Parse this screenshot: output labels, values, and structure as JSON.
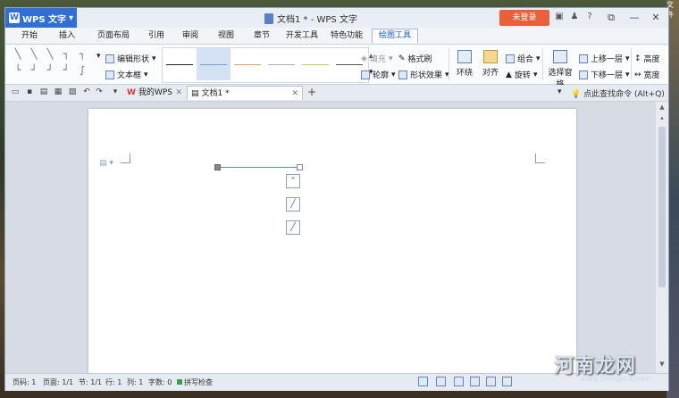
{
  "app": {
    "name": "WPS 文字",
    "doc_title": "文档1 * - WPS 文字",
    "login": "未登录"
  },
  "menu_tabs": [
    "开始",
    "插入",
    "页面布局",
    "引用",
    "审阅",
    "视图",
    "章节",
    "开发工具",
    "特色功能",
    "绘图工具"
  ],
  "active_tab": "绘图工具",
  "ribbon": {
    "edit_shape": "编辑形状",
    "textbox": "文本框",
    "fill": "填充",
    "format_painter": "格式刷",
    "outline": "轮廓",
    "shape_effects": "形状效果",
    "wrap": "环绕",
    "align": "对齐",
    "group": "组合",
    "rotate": "旋转",
    "selection_pane": "选择窗格",
    "bring_forward": "上移一层",
    "send_backward": "下移一层",
    "height": "高度",
    "width": "宽度",
    "line_styles": [
      "#222222",
      "#7a9cd8",
      "#e0a060",
      "#b0b0b0",
      "#c8c860",
      "#555555"
    ]
  },
  "doc_tabs": {
    "home": "我的WPS",
    "doc": "文档1 *"
  },
  "search_hint": "点此查找命令 (Alt+Q)",
  "status": {
    "page": "页码: 1",
    "pages": "页面: 1/1",
    "section": "节: 1/1",
    "row": "行: 1",
    "col": "列: 1",
    "words": "字数: 0",
    "spell": "拼写检查"
  },
  "watermark": {
    "brand": "河南龙网",
    "url": "www.zhenpma.com"
  },
  "desktop": {
    "corner": "文件"
  }
}
